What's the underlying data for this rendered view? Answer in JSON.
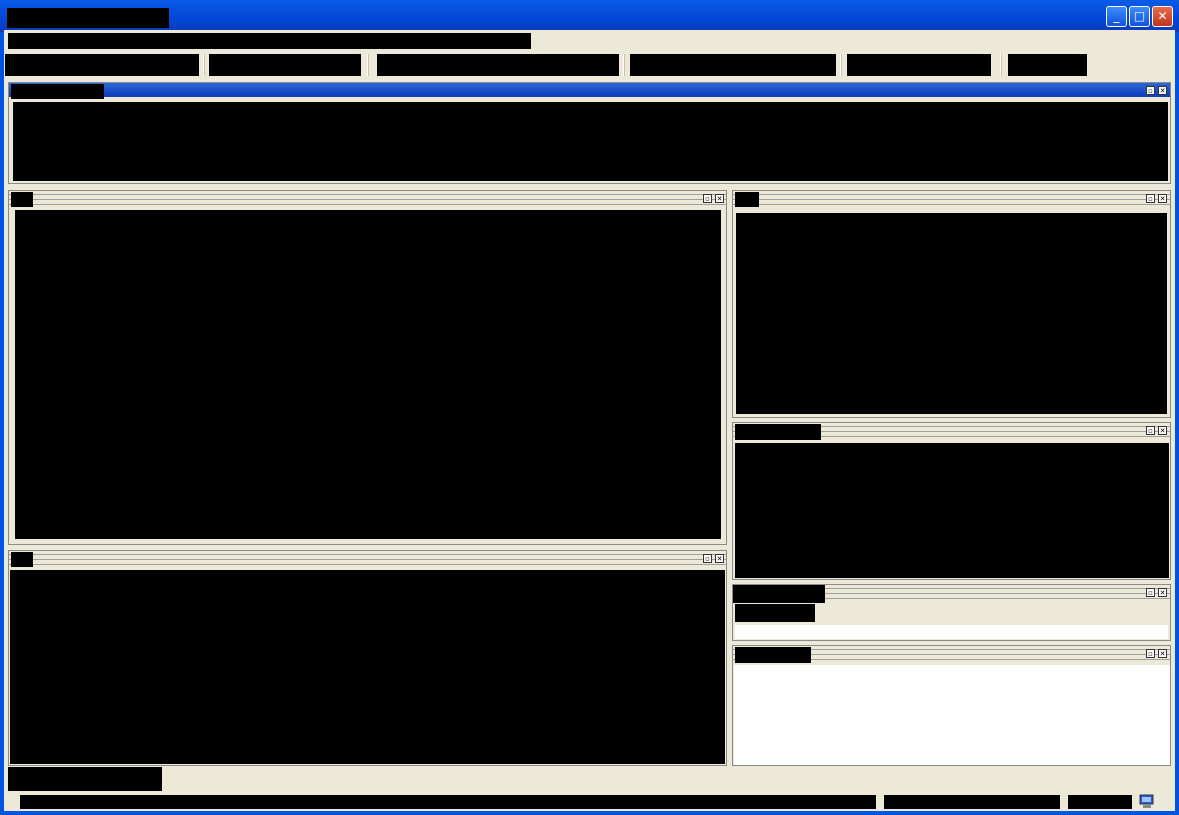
{
  "window": {
    "title": "",
    "controls": [
      "minimize-icon",
      "maximize-icon",
      "close-icon"
    ]
  },
  "menu_bar": {
    "text": ""
  },
  "toolbar": {
    "items": [
      "",
      "",
      "",
      "",
      "",
      ""
    ]
  },
  "panes": {
    "top": {
      "title": ""
    },
    "main": {
      "title": ""
    },
    "bottom_left": {
      "title": ""
    },
    "right_top": {
      "title": ""
    },
    "right_mid": {
      "title": ""
    },
    "right_small": {
      "title": "",
      "field": ""
    },
    "right_bottom": {
      "title": ""
    }
  },
  "bottom_tab": {
    "label": ""
  },
  "status_bar": {
    "main": "",
    "secondary": "",
    "tertiary": ""
  },
  "colors": {
    "title_bar": "#0054e3",
    "face": "#ece9d8",
    "redaction": "#000000"
  }
}
